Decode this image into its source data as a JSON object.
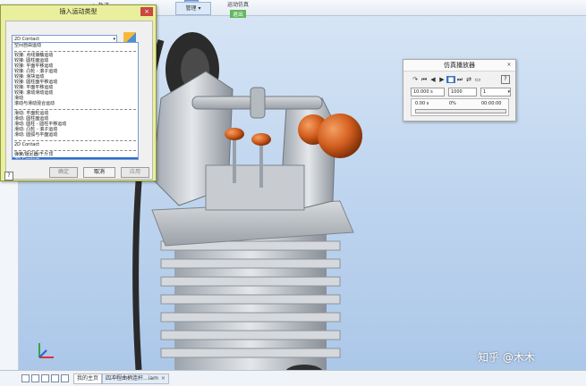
{
  "ribbon": {
    "view_label": "轨迹",
    "manage_label": "管理",
    "sim_label": "运动仿真",
    "exit_label": "退出"
  },
  "dialog": {
    "title": "插入运动类型",
    "close_label": "×",
    "selected_value": "2D Contact",
    "options": [
      "空间自由运动",
      "",
      "铰接: 点线接触运动",
      "铰接: 圆柱面运动",
      "铰接: 平面平移运动",
      "铰接: 凸轮 - 滚子运动",
      "铰接: 滑块运动",
      "铰接: 圆柱面平移运动",
      "铰接: 平面平移运动",
      "铰接: 滚动滑动运动",
      "滑动",
      "滚动与滑动混合运动",
      "",
      "滑动: 平面轮运动",
      "滑动: 圆柱面运动",
      "滑动: 圆柱 - 圆柱平移运动",
      "滑动: 凸轮 - 滚子运动",
      "滑动: 圆弧与平面运动",
      "",
      "2D Contact",
      "",
      "弹簧/阻尼器/千斤顶",
      "2D Contact"
    ],
    "selected_index": 22,
    "ok_label": "确定",
    "cancel_label": "取消",
    "apply_label": "应用",
    "help_label": "?"
  },
  "player": {
    "title": "仿真播放器",
    "close_label": "×",
    "controls": [
      "↷",
      "⏮",
      "◀",
      "▶",
      "■",
      "⏭",
      "⇄",
      "▭"
    ],
    "active_control_index": 4,
    "end_time": "10.000 s",
    "steps": "1000",
    "rate": "1",
    "current_time": "0.00 s",
    "percent": "0%",
    "elapsed": "00:00:00",
    "help_label": "?"
  },
  "statusbar": {
    "tabs": [
      {
        "label": "我的主页"
      },
      {
        "label": "四冲程曲柄连杆...iam"
      }
    ]
  },
  "watermark": "知乎 @木木",
  "colors": {
    "dialog_bg": "#e9ef9c",
    "selection": "#2d6fd1",
    "part_orange": "#d35f1f",
    "viewport_top": "#d8e6f6"
  }
}
